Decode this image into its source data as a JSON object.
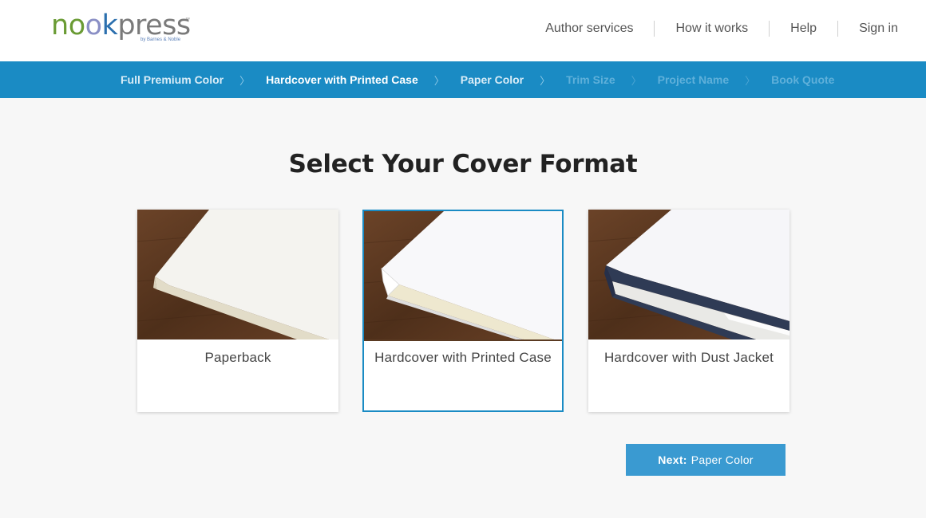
{
  "brand": {
    "logo_parts": [
      "n",
      "o",
      "o",
      "k",
      "press"
    ],
    "tm": "™",
    "byline": "by Barnes & Noble"
  },
  "top_nav": [
    "Author services",
    "How it works",
    "Help",
    "Sign in"
  ],
  "breadcrumbs": [
    {
      "label": "Full Premium Color",
      "state": "done"
    },
    {
      "label": "Hardcover with Printed Case",
      "state": "active"
    },
    {
      "label": "Paper Color",
      "state": "next"
    },
    {
      "label": "Trim Size",
      "state": "disabled"
    },
    {
      "label": "Project Name",
      "state": "disabled"
    },
    {
      "label": "Book Quote",
      "state": "disabled"
    }
  ],
  "page_title": "Select Your Cover Format",
  "options": [
    {
      "label": "Paperback",
      "selected": false
    },
    {
      "label": "Hardcover with Printed Case",
      "selected": true
    },
    {
      "label": "Hardcover with Dust Jacket",
      "selected": false
    }
  ],
  "next_button": {
    "prefix": "Next:",
    "destination": "Paper Color"
  },
  "colors": {
    "brand_blue": "#1a8bc4",
    "button_blue": "#3a9ad1",
    "logo_green": "#6a9b34"
  }
}
